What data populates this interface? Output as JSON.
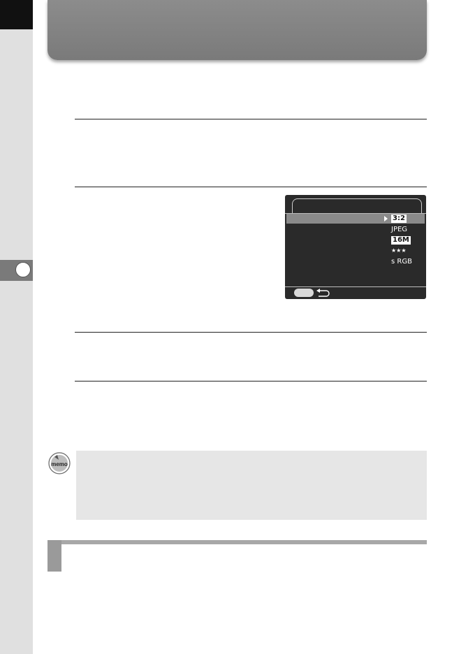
{
  "page": {
    "chapter_number": ""
  },
  "camera_screen": {
    "rows": [
      {
        "value": "3:2",
        "style": "boxed",
        "selected": true
      },
      {
        "value": "JPEG",
        "style": "plain",
        "selected": false
      },
      {
        "value": "16M",
        "style": "boxed",
        "selected": false
      },
      {
        "value": "★★★",
        "style": "plain",
        "selected": false
      },
      {
        "value": "s RGB",
        "style": "plain",
        "selected": false
      }
    ]
  },
  "colors": {
    "side_strip": "#e0e0e0",
    "banner": "#808080",
    "memo_background": "#e6e6e6",
    "section_bar": "#9a9a9a"
  },
  "icons": {
    "memo": "memo-icon",
    "back": "back-arrow-icon"
  }
}
